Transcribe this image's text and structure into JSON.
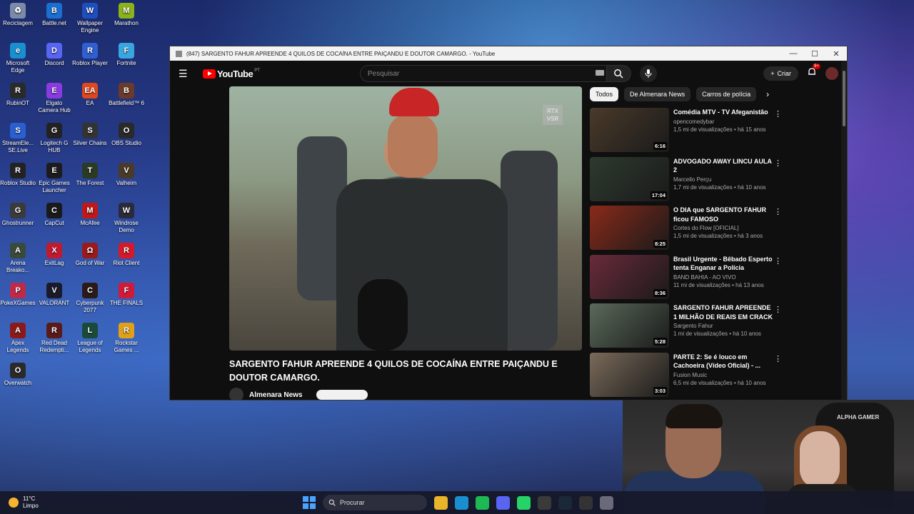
{
  "desktop": {
    "icons": [
      {
        "label": "Reciclagem",
        "icon": "recycle-bin-icon",
        "color": "#7a8aa8",
        "glyph": "♻"
      },
      {
        "label": "Battle.net",
        "icon": "battlenet-icon",
        "color": "#1b6fd1",
        "glyph": "B"
      },
      {
        "label": "Wallpaper Engine",
        "icon": "wallpaper-engine-icon",
        "color": "#1e4fbf",
        "glyph": "W"
      },
      {
        "label": "Marathon",
        "icon": "marathon-icon",
        "color": "#8ab21a",
        "glyph": "M"
      },
      {
        "label": "Microsoft Edge",
        "icon": "edge-icon",
        "color": "#1a8fcf",
        "glyph": "e"
      },
      {
        "label": "Discord",
        "icon": "discord-icon",
        "color": "#5865f2",
        "glyph": "D"
      },
      {
        "label": "Roblox Player",
        "icon": "roblox-icon",
        "color": "#2f5fd0",
        "glyph": "R"
      },
      {
        "label": "Fortnite",
        "icon": "fortnite-icon",
        "color": "#3aa6e0",
        "glyph": "F"
      },
      {
        "label": "RubinOT",
        "icon": "rubinot-icon",
        "color": "#2a2a2a",
        "glyph": "R"
      },
      {
        "label": "Elgato Camera Hub",
        "icon": "elgato-icon",
        "color": "#8a3be0",
        "glyph": "E"
      },
      {
        "label": "EA",
        "icon": "ea-icon",
        "color": "#e0471e",
        "glyph": "EA"
      },
      {
        "label": "Battlefield™ 6",
        "icon": "battlefield-icon",
        "color": "#6a3a2a",
        "glyph": "B"
      },
      {
        "label": "StreamEle... SE.Live",
        "icon": "streamelements-icon",
        "color": "#2a5fd0",
        "glyph": "S"
      },
      {
        "label": "Logitech G HUB",
        "icon": "logitech-icon",
        "color": "#222222",
        "glyph": "G"
      },
      {
        "label": "Silver Chains",
        "icon": "silver-chains-icon",
        "color": "#333333",
        "glyph": "S"
      },
      {
        "label": "OBS Studio",
        "icon": "obs-icon",
        "color": "#2a2a2a",
        "glyph": "O"
      },
      {
        "label": "Roblox Studio",
        "icon": "roblox-studio-icon",
        "color": "#222222",
        "glyph": "R"
      },
      {
        "label": "Epic Games Launcher",
        "icon": "epic-games-icon",
        "color": "#1c1c1c",
        "glyph": "E"
      },
      {
        "label": "The Forest",
        "icon": "the-forest-icon",
        "color": "#2b3a22",
        "glyph": "T"
      },
      {
        "label": "Valheim",
        "icon": "valheim-icon",
        "color": "#4a3a2a",
        "glyph": "V"
      },
      {
        "label": "Ghostrunner",
        "icon": "ghostrunner-icon",
        "color": "#3a3a3a",
        "glyph": "G"
      },
      {
        "label": "CapCut",
        "icon": "capcut-icon",
        "color": "#1a1a1a",
        "glyph": "C"
      },
      {
        "label": "McAfee",
        "icon": "mcafee-icon",
        "color": "#c01818",
        "glyph": "M"
      },
      {
        "label": "Windrose Demo",
        "icon": "windrose-icon",
        "color": "#2a2a3a",
        "glyph": "W"
      },
      {
        "label": "Arena Breako...",
        "icon": "arena-breakout-icon",
        "color": "#3a4a3a",
        "glyph": "A"
      },
      {
        "label": "ExitLag",
        "icon": "exitlag-icon",
        "color": "#c01a30",
        "glyph": "X"
      },
      {
        "label": "God of War",
        "icon": "god-of-war-icon",
        "color": "#9a1a1a",
        "glyph": "Ω"
      },
      {
        "label": "Riot Client",
        "icon": "riot-client-icon",
        "color": "#d41a2a",
        "glyph": "R"
      },
      {
        "label": "PokeXGames",
        "icon": "pokexgames-icon",
        "color": "#c02a4a",
        "glyph": "P"
      },
      {
        "label": "VALORANT",
        "icon": "valorant-icon",
        "color": "#1a1a2a",
        "glyph": "V"
      },
      {
        "label": "Cyberpunk 2077",
        "icon": "cyberpunk-icon",
        "color": "#2a1a1a",
        "glyph": "C"
      },
      {
        "label": "THE FINALS",
        "icon": "the-finals-icon",
        "color": "#d01a3a",
        "glyph": "F"
      },
      {
        "label": "Apex Legends",
        "icon": "apex-legends-icon",
        "color": "#8a1a1a",
        "glyph": "A"
      },
      {
        "label": "Red Dead Redempti...",
        "icon": "red-dead-icon",
        "color": "#5a1a1a",
        "glyph": "R"
      },
      {
        "label": "League of Legends",
        "icon": "league-icon",
        "color": "#1a4a3a",
        "glyph": "L"
      },
      {
        "label": "Rockstar Games ...",
        "icon": "rockstar-icon",
        "color": "#e0a01a",
        "glyph": "R"
      },
      {
        "label": "Overwatch",
        "icon": "overwatch-icon",
        "color": "#2a2a2a",
        "glyph": "O"
      }
    ]
  },
  "window": {
    "title": "(847) SARGENTO FAHUR APREENDE 4 QUILOS DE COCAÍNA ENTRE PAIÇANDU E DOUTOR CAMARGO. - YouTube",
    "minimize": "—",
    "maximize": "☐",
    "close": "✕"
  },
  "youtube": {
    "logo_text": "YouTube",
    "country_code": "PT",
    "search_placeholder": "Pesquisar",
    "create_label": "Criar",
    "notifications_badge": "9+",
    "video": {
      "overlay_badge": "RTX VSR",
      "title": "SARGENTO FAHUR APREENDE 4 QUILOS DE COCAÍNA ENTRE PAIÇANDU E DOUTOR CAMARGO.",
      "channel": "Almenara News"
    },
    "chips": [
      "Todos",
      "De Almenara News",
      "Carros de polícia"
    ],
    "recommendations": [
      {
        "title": "Comédia MTV - TV Afeganistão",
        "channel": "opencomedybar",
        "meta": "1,5 mi de visualizações • há 15 anos",
        "duration": "6:16",
        "thumb": "#4a3a2a"
      },
      {
        "title": "ADVOGADO AWAY LINCU AULA 2",
        "channel": "Marcello Perçu",
        "meta": "1,7 mi de visualizações • há 10 anos",
        "duration": "17:04",
        "thumb": "#2e3a2e"
      },
      {
        "title": "O DIA que SARGENTO FAHUR ficou FAMOSO",
        "channel": "Cortes do Flow [OFICIAL]",
        "meta": "1,5 mi de visualizações • há 3 anos",
        "duration": "8:25",
        "thumb": "#8a2a1a"
      },
      {
        "title": "Brasil Urgente -  Bêbado Esperto tenta Enganar a Polícia",
        "channel": "BAND BAHIA - AO VIVO",
        "meta": "11 mi de visualizações • há 13 anos",
        "duration": "8:36",
        "thumb": "#6a2a3a"
      },
      {
        "title": "SARGENTO FAHUR APREENDE 1 MILHÃO DE REAIS EM CRACK",
        "channel": "Sargento Fahur",
        "meta": "1 mi de visualizações • há 10 anos",
        "duration": "5:28",
        "thumb": "#5a6a5a"
      },
      {
        "title": "PARTE 2: Se é louco em Cachoeira (Vídeo Oficial) - ...",
        "channel": "Fusion Music",
        "meta": "6,5 mi de visualizações • há 10 anos",
        "duration": "3:03",
        "thumb": "#7a6a5a"
      }
    ]
  },
  "taskbar": {
    "temperature": "11°C",
    "condition": "Limpo",
    "search_label": "Procurar",
    "apps": [
      {
        "icon": "file-explorer-icon",
        "color": "#e8b42a"
      },
      {
        "icon": "edge-icon",
        "color": "#1a8fcf"
      },
      {
        "icon": "spotify-icon",
        "color": "#1db954"
      },
      {
        "icon": "discord-icon",
        "color": "#5865f2"
      },
      {
        "icon": "whatsapp-icon",
        "color": "#25d366"
      },
      {
        "icon": "obs-icon",
        "color": "#3a3a3a"
      },
      {
        "icon": "steam-icon",
        "color": "#1b2838"
      },
      {
        "icon": "logitech-icon",
        "color": "#333333"
      },
      {
        "icon": "settings-icon",
        "color": "#6a6a7a"
      }
    ]
  },
  "webcam": {
    "chair_brand": "ALPHA GAMER"
  }
}
